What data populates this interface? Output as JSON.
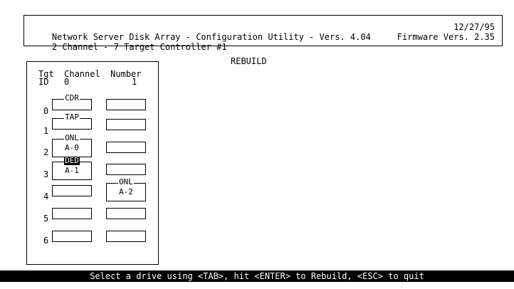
{
  "header": {
    "line1_left": "Network Server Disk Array - Configuration Utility - Vers. 4.04",
    "line1_right": "12/27/95",
    "line2_left": "2 Channel - 7 Target Controller #1",
    "line2_right": "Firmware Vers. 2.35"
  },
  "screen_title": "REBUILD",
  "panel": {
    "header_line1": "Tgt  Channel  Number",
    "header_tgt": "ID",
    "channel_0": "0",
    "channel_1": "1",
    "rows": [
      {
        "id": "0",
        "ch0_status": "CDR",
        "ch0_array": "",
        "ch1_status": "",
        "ch1_array": ""
      },
      {
        "id": "1",
        "ch0_status": "TAP",
        "ch0_array": "",
        "ch1_status": "",
        "ch1_array": ""
      },
      {
        "id": "2",
        "ch0_status": "ONL",
        "ch0_array": "A-0",
        "ch1_status": "",
        "ch1_array": ""
      },
      {
        "id": "3",
        "ch0_status": "DED",
        "ch0_array": "A-1",
        "ch1_status": "",
        "ch1_array": ""
      },
      {
        "id": "4",
        "ch0_status": "",
        "ch0_array": "",
        "ch1_status": "ONL",
        "ch1_array": "A-2"
      },
      {
        "id": "5",
        "ch0_status": "",
        "ch0_array": "",
        "ch1_status": "",
        "ch1_array": ""
      },
      {
        "id": "6",
        "ch0_status": "",
        "ch0_array": "",
        "ch1_status": "",
        "ch1_array": ""
      }
    ]
  },
  "status_bar": "Select a drive using <TAB>, hit <ENTER> to Rebuild, <ESC> to quit"
}
